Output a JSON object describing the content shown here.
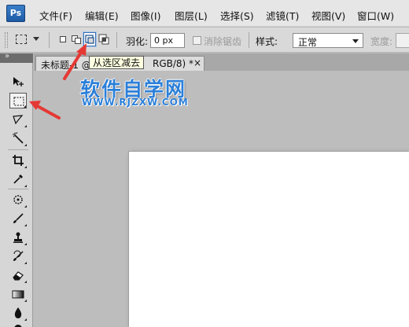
{
  "app": {
    "logo_text": "Ps",
    "accent_color": "#1f5ba6",
    "annotation_color": "#e53935"
  },
  "menu": {
    "items": [
      "文件(F)",
      "编辑(E)",
      "图像(I)",
      "图层(L)",
      "选择(S)",
      "滤镜(T)",
      "视图(V)",
      "窗口(W)"
    ]
  },
  "options_bar": {
    "tool_preset_icon": "rect-marquee-icon",
    "selection_modes": [
      {
        "name": "new-selection-icon",
        "active": false
      },
      {
        "name": "add-to-selection-icon",
        "active": false
      },
      {
        "name": "subtract-from-selection-icon",
        "active": true
      },
      {
        "name": "intersect-selection-icon",
        "active": false
      }
    ],
    "feather_label": "羽化:",
    "feather_value": "0 px",
    "antialias_label": "消除锯齿",
    "style_label": "样式:",
    "style_value": "正常",
    "width_label": "宽度:"
  },
  "tooltip": {
    "text": "从选区减去"
  },
  "document_tab": {
    "title": "未标题-1 @",
    "mode": "RGB/8) *",
    "close": "×"
  },
  "watermark": {
    "title": "软件自学网",
    "url": "WWW.RJZXW.COM"
  },
  "toolbox": {
    "header_expand": "»",
    "tools": [
      {
        "name": "move-tool-icon",
        "glyph": "▸✛",
        "active": false
      },
      {
        "name": "rect-marquee-tool-icon",
        "glyph": "",
        "active": true
      },
      {
        "name": "lasso-tool-icon",
        "glyph": "ᘏ",
        "active": false
      },
      {
        "name": "magic-wand-tool-icon",
        "glyph": "⁂",
        "active": false
      },
      {
        "name": "crop-tool-icon",
        "glyph": "⌗",
        "active": false
      },
      {
        "name": "eyedropper-tool-icon",
        "glyph": "⁄",
        "active": false
      },
      {
        "name": "healing-brush-tool-icon",
        "glyph": "✺",
        "active": false
      },
      {
        "name": "brush-tool-icon",
        "glyph": "⟋",
        "active": false
      },
      {
        "name": "clone-stamp-tool-icon",
        "glyph": "⊥",
        "active": false
      },
      {
        "name": "history-brush-tool-icon",
        "glyph": "↺",
        "active": false
      },
      {
        "name": "eraser-tool-icon",
        "glyph": "◪",
        "active": false
      },
      {
        "name": "gradient-tool-icon",
        "glyph": "▬",
        "active": false
      },
      {
        "name": "blur-tool-icon",
        "glyph": "◆",
        "active": false
      },
      {
        "name": "dodge-tool-icon",
        "glyph": "●",
        "active": false
      }
    ]
  }
}
